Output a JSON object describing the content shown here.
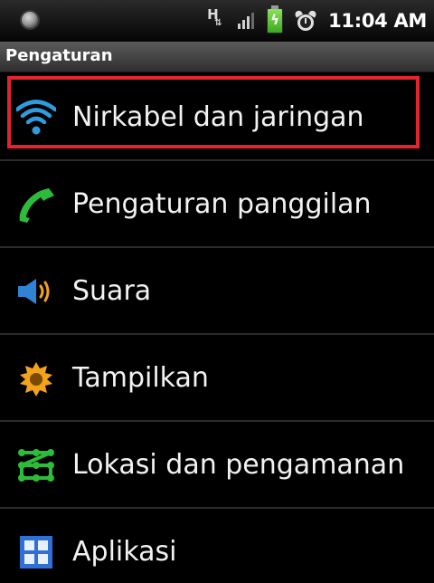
{
  "statusbar": {
    "network_icon": "hspa-icon",
    "network_letter": "H",
    "network_arrows": "⇅",
    "signal_icon": "signal-icon",
    "battery_icon": "battery-charging-icon",
    "battery_color": "#5cc934",
    "alarm_icon": "alarm-clock-icon",
    "time": "11:04 AM"
  },
  "titlebar": {
    "title": "Pengaturan"
  },
  "settings": {
    "items": [
      {
        "label": "Nirkabel dan jaringan",
        "icon": "wifi-icon",
        "color": "#2f9ce0",
        "highlighted": true
      },
      {
        "label": "Pengaturan panggilan",
        "icon": "phone-icon",
        "color": "#2dbb3a"
      },
      {
        "label": "Suara",
        "icon": "speaker-icon",
        "color": "#2f84d6"
      },
      {
        "label": "Tampilkan",
        "icon": "brightness-icon",
        "color": "#f2a21b"
      },
      {
        "label": "Lokasi dan pengamanan",
        "icon": "lock-pattern-icon",
        "color": "#2dbb3a"
      },
      {
        "label": "Aplikasi",
        "icon": "apps-grid-icon",
        "color": "#2f6fd6"
      }
    ]
  },
  "highlight_color": "#e3232d"
}
